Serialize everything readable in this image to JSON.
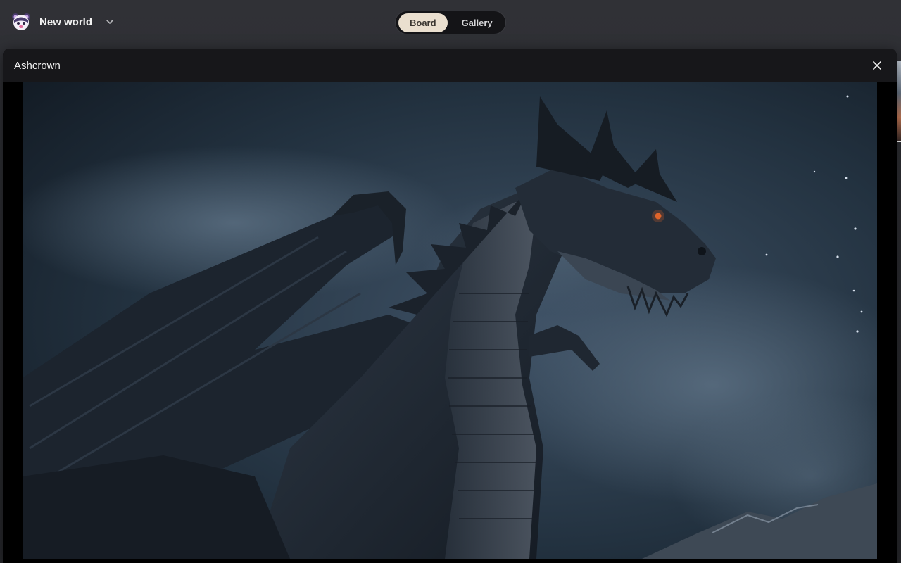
{
  "header": {
    "world_name": "New world",
    "logo_icon": "bear-mascot-icon",
    "dropdown_icon": "chevron-down-icon"
  },
  "view_toggle": {
    "options": [
      {
        "label": "Board",
        "active": true
      },
      {
        "label": "Gallery",
        "active": false
      }
    ]
  },
  "modal": {
    "title": "Ashcrown",
    "close_icon": "close-icon",
    "image_subject": "dark dragon against night sky"
  },
  "colors": {
    "accent": "#eadfcf",
    "background": "#2a2b2f",
    "modal_header": "#17171a",
    "dragon_eye": "#e0642a"
  }
}
